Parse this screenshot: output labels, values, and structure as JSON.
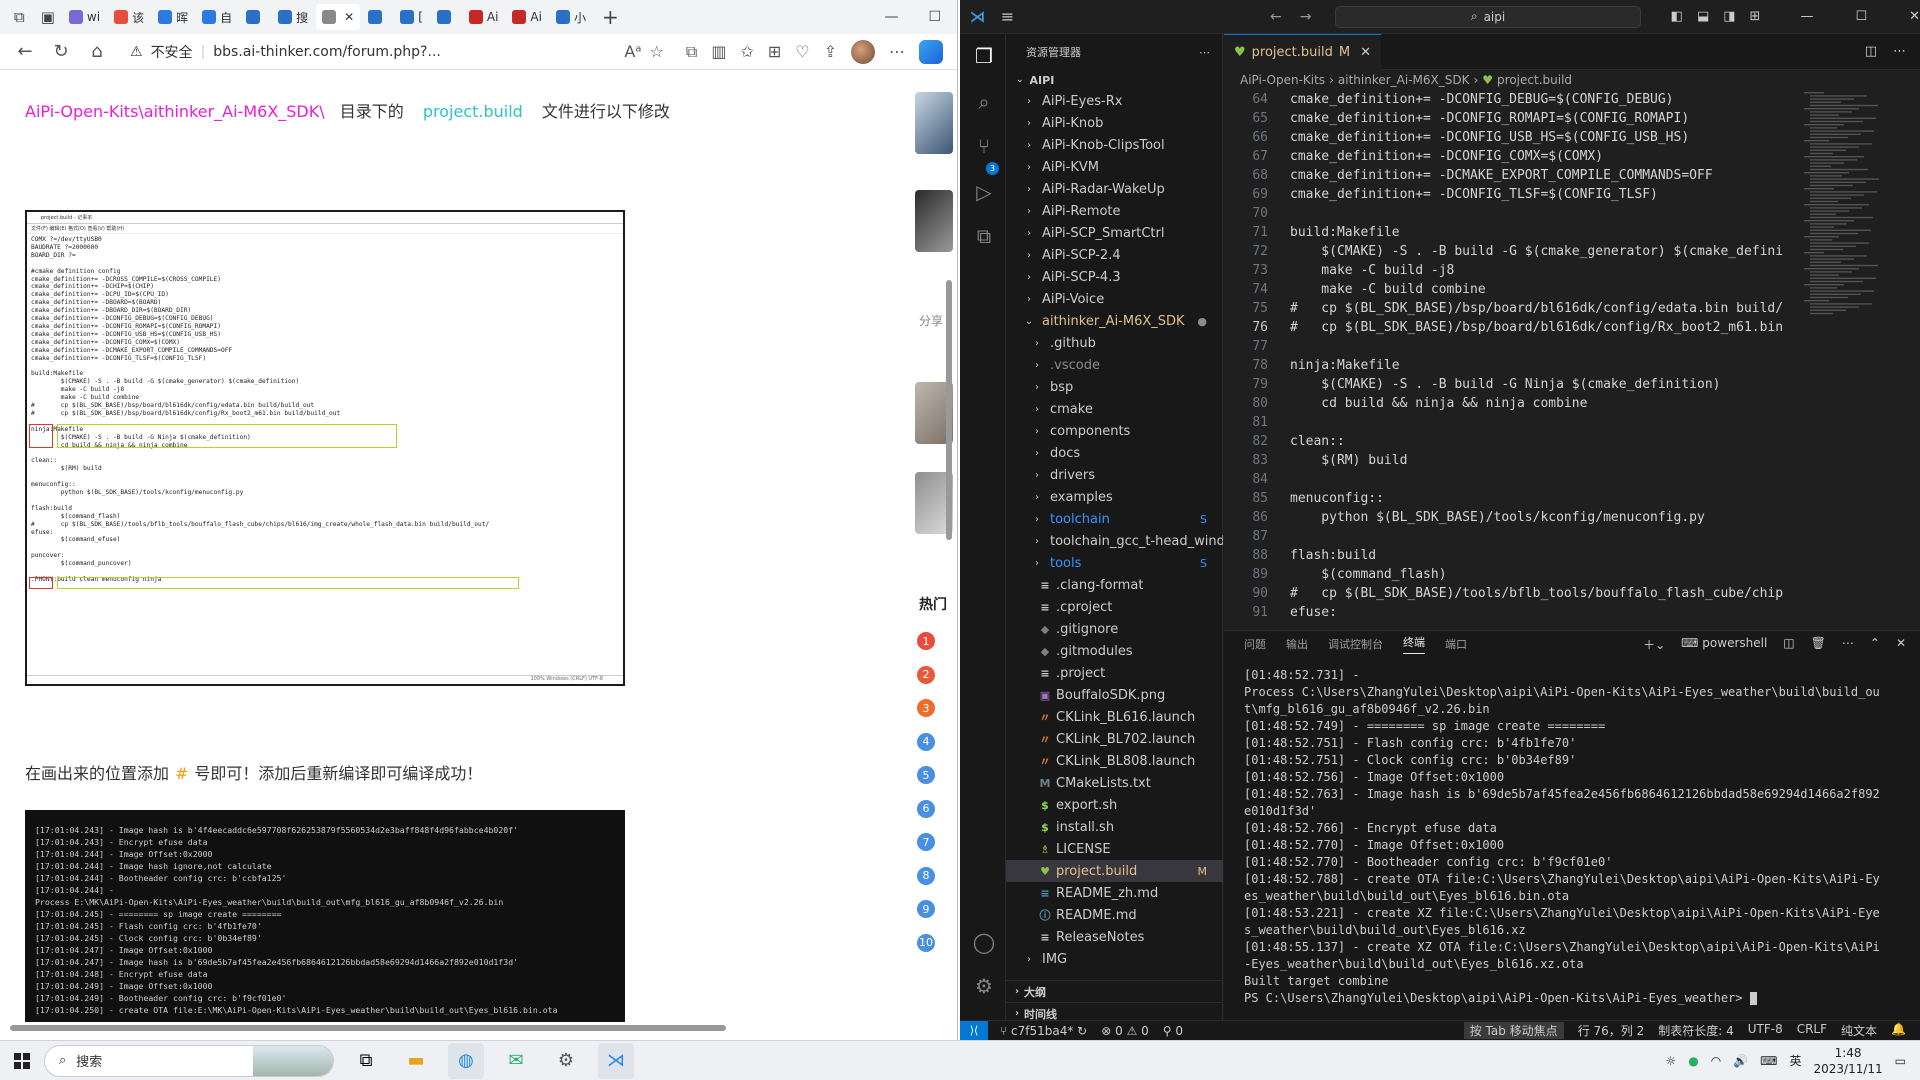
{
  "browser": {
    "tabs": [
      {
        "label": "wi",
        "color": "#7c69d8"
      },
      {
        "label": "该",
        "color": "#e74c3c"
      },
      {
        "label": "晖",
        "color": "#2a7ae2"
      },
      {
        "label": "自",
        "color": "#2a7ae2"
      },
      {
        "label": "",
        "color": "#2a70c8"
      },
      {
        "label": "搜",
        "color": "#2a70c8"
      },
      {
        "label": "",
        "color": "#888888"
      },
      {
        "label": "",
        "color": "#2a70c8"
      },
      {
        "label": "[",
        "color": "#2a70c8"
      },
      {
        "label": "",
        "color": "#2a70c8"
      },
      {
        "label": "Ai",
        "color": "#c62828"
      },
      {
        "label": "Ai",
        "color": "#c62828"
      },
      {
        "label": "小",
        "color": "#2a70c8"
      }
    ],
    "insecure_label": "不安全",
    "url": "bbs.ai-thinker.com/forum.php?...",
    "article": {
      "path": "AiPi-Open-Kits\\aithinker_Ai-M6X_SDK\\",
      "text1": "目录下的",
      "file": "project.build",
      "text2": "文件进行以下修改",
      "para_before": "在画出来的位置添加",
      "hash": "#",
      "para_after": "号即可！添加后重新编译即可编译成功！"
    },
    "notepad": {
      "title": "project.build - 记事本",
      "menu": "文件(F)   编辑(E)   格式(O)   查看(V)   帮助(H)",
      "body": "COMX ?=/dev/ttyUSB0\nBAUDRATE ?=2000000\nBOARD_DIR ?=\n\n#cmake definition config\ncmake_definition+= -DCROSS_COMPILE=$(CROSS_COMPILE)\ncmake_definition+= -DCHIP=$(CHIP)\ncmake_definition+= -DCPU_ID=$(CPU_ID)\ncmake_definition+= -DBOARD=$(BOARD)\ncmake_definition+= -DBOARD_DIR=$(BOARD_DIR)\ncmake_definition+= -DCONFIG_DEBUG=$(CONFIG_DEBUG)\ncmake_definition+= -DCONFIG_ROMAPI=$(CONFIG_ROMAPI)\ncmake_definition+= -DCONFIG_USB_HS=$(CONFIG_USB_HS)\ncmake_definition+= -DCONFIG_COMX=$(COMX)\ncmake_definition+= -DCMAKE_EXPORT_COMPILE_COMMANDS=OFF\ncmake_definition+= -DCONFIG_TLSF=$(CONFIG_TLSF)\n\nbuild:Makefile\n        $(CMAKE) -S . -B build -G $(cmake_generator) $(cmake_definition)\n        make -C build -j8\n        make -C build combine\n#       cp $(BL_SDK_BASE)/bsp/board/bl616dk/config/edata.bin build/build_out\n#       cp $(BL_SDK_BASE)/bsp/board/bl616dk/config/Rx_boot2_m61.bin build/build_out\n\nninja:Makefile\n        $(CMAKE) -S . -B build -G Ninja $(cmake_definition)\n        cd build && ninja && ninja combine\n\nclean::\n        $(RM) build\n\nmenuconfig::\n        python $(BL_SDK_BASE)/tools/kconfig/menuconfig.py\n\nflash:build\n        $(command_flash)\n#       cp $(BL_SDK_BASE)/tools/bflb_tools/bouffalo_flash_cube/chips/bl616/img_create/whole_flash_data.bin build/build_out/\nefuse:\n        $(command_efuse)\n\npuncover:\n        $(command_puncover)\n\n.PHONY:build clean menuconfig ninja",
      "status": "100%    Windows (CRLF)    UTF-8"
    },
    "log_lines": [
      "[17:01:04.243] - Image hash is b'4f4eecaddc6e597708f626253879f5560534d2e3baff848f4d96fabbce4b020f'",
      "[17:01:04.243] - Encrypt efuse data",
      "[17:01:04.244] - Image Offset:0x2000",
      "[17:01:04.244] - Image hash ignore,not calculate",
      "[17:01:04.244] - Bootheader config crc: b'ccbfa125'",
      "[17:01:04.244] -",
      "Process E:\\MK\\AiPi-Open-Kits\\AiPi-Eyes_weather\\build\\build_out\\mfg_bl616_gu_af8b0946f_v2.26.bin",
      "[17:01:04.245] - ======== sp image create ========",
      "[17:01:04.245] - Flash config crc: b'4fb1fe70'",
      "[17:01:04.245] - Clock config crc: b'0b34ef89'",
      "[17:01:04.247] - Image Offset:0x1000",
      "[17:01:04.247] - Image hash is b'69de5b7af45fea2e456fb6864612126bbdad58e69294d1466a2f892e010d1f3d'",
      "[17:01:04.248] - Encrypt efuse data",
      "[17:01:04.249] - Image Offset:0x1000",
      "[17:01:04.249] - Bootheader config crc: b'f9cf01e0'",
      "[17:01:04.250] - create OTA file:E:\\MK\\AiPi-Open-Kits\\AiPi-Eyes_weather\\build\\build_out\\Eyes_bl616.bin.ota"
    ],
    "rail": {
      "share": "分享",
      "hot": "热门",
      "numbers": [
        "1",
        "2",
        "3",
        "4",
        "5",
        "6",
        "7",
        "8",
        "9",
        "10"
      ]
    }
  },
  "vscode": {
    "search": "aipi",
    "explorer_title": "资源管理器",
    "root": "AIPI",
    "tree": [
      {
        "label": "AiPi-Eyes-Rx",
        "type": "folder",
        "indent": 1
      },
      {
        "label": "AiPi-Knob",
        "type": "folder",
        "indent": 1
      },
      {
        "label": "AiPi-Knob-ClipsTool",
        "type": "folder",
        "indent": 1
      },
      {
        "label": "AiPi-KVM",
        "type": "folder",
        "indent": 1
      },
      {
        "label": "AiPi-Radar-WakeUp",
        "type": "folder",
        "indent": 1
      },
      {
        "label": "AiPi-Remote",
        "type": "folder",
        "indent": 1
      },
      {
        "label": "AiPi-SCP_SmartCtrl",
        "type": "folder",
        "indent": 1
      },
      {
        "label": "AiPi-SCP-2.4",
        "type": "folder",
        "indent": 1
      },
      {
        "label": "AiPi-SCP-4.3",
        "type": "folder",
        "indent": 1
      },
      {
        "label": "AiPi-Voice",
        "type": "folder",
        "indent": 1
      },
      {
        "label": "aithinker_Ai-M6X_SDK",
        "type": "folder-open",
        "indent": 1,
        "status": "●",
        "cls": "mod"
      },
      {
        "label": ".github",
        "type": "folder",
        "indent": 2
      },
      {
        "label": ".vscode",
        "type": "folder",
        "indent": 2,
        "cls": "dim"
      },
      {
        "label": "bsp",
        "type": "folder",
        "indent": 2
      },
      {
        "label": "cmake",
        "type": "folder",
        "indent": 2
      },
      {
        "label": "components",
        "type": "folder",
        "indent": 2
      },
      {
        "label": "docs",
        "type": "folder",
        "indent": 2
      },
      {
        "label": "drivers",
        "type": "folder",
        "indent": 2
      },
      {
        "label": "examples",
        "type": "folder",
        "indent": 2
      },
      {
        "label": "toolchain",
        "type": "folder",
        "indent": 2,
        "status": "S",
        "cls": "sub"
      },
      {
        "label": "toolchain_gcc_t-head_windows",
        "type": "folder",
        "indent": 2
      },
      {
        "label": "tools",
        "type": "folder",
        "indent": 2,
        "status": "S",
        "cls": "sub"
      },
      {
        "label": ".clang-format",
        "type": "file",
        "indent": 2,
        "icon": "≡",
        "icolor": "#cccccc"
      },
      {
        "label": ".cproject",
        "type": "file",
        "indent": 2,
        "icon": "≡",
        "icolor": "#cccccc"
      },
      {
        "label": ".gitignore",
        "type": "file",
        "indent": 2,
        "icon": "◆",
        "icolor": "#7f7f7f"
      },
      {
        "label": ".gitmodules",
        "type": "file",
        "indent": 2,
        "icon": "◆",
        "icolor": "#7f7f7f"
      },
      {
        "label": ".project",
        "type": "file",
        "indent": 2,
        "icon": "≡",
        "icolor": "#cccccc"
      },
      {
        "label": "BouffaloSDK.png",
        "type": "file",
        "indent": 2,
        "icon": "▣",
        "icolor": "#a074c4"
      },
      {
        "label": "CKLink_BL616.launch",
        "type": "file",
        "indent": 2,
        "icon": "〃",
        "icolor": "#e37933"
      },
      {
        "label": "CKLink_BL702.launch",
        "type": "file",
        "indent": 2,
        "icon": "〃",
        "icolor": "#e37933"
      },
      {
        "label": "CKLink_BL808.launch",
        "type": "file",
        "indent": 2,
        "icon": "〃",
        "icolor": "#e37933"
      },
      {
        "label": "CMakeLists.txt",
        "type": "file",
        "indent": 2,
        "icon": "M",
        "icolor": "#6d8086"
      },
      {
        "label": "export.sh",
        "type": "file",
        "indent": 2,
        "icon": "$",
        "icolor": "#89e051"
      },
      {
        "label": "install.sh",
        "type": "file",
        "indent": 2,
        "icon": "$",
        "icolor": "#89e051"
      },
      {
        "label": "LICENSE",
        "type": "file",
        "indent": 2,
        "icon": "♗",
        "icolor": "#cbcb41"
      },
      {
        "label": "project.build",
        "type": "file",
        "indent": 2,
        "icon": "♥",
        "icolor": "#8dc149",
        "status": "M",
        "cls": "mod sel"
      },
      {
        "label": "README_zh.md",
        "type": "file",
        "indent": 2,
        "icon": "≡",
        "icolor": "#519aba"
      },
      {
        "label": "README.md",
        "type": "file",
        "indent": 2,
        "icon": "ⓘ",
        "icolor": "#519aba"
      },
      {
        "label": "ReleaseNotes",
        "type": "file",
        "indent": 2,
        "icon": "≡",
        "icolor": "#cccccc"
      },
      {
        "label": "IMG",
        "type": "folder",
        "indent": 1
      }
    ],
    "outline_label": "大纲",
    "timeline_label": "时间线",
    "tab_label": "project.build",
    "tab_status": "M",
    "crumbs": [
      "AiPi-Open-Kits",
      "aithinker_Ai-M6X_SDK",
      "project.build"
    ],
    "code": [
      {
        "n": "64",
        "t": "cmake_definition+= -DCONFIG_DEBUG=$(CONFIG_DEBUG)"
      },
      {
        "n": "65",
        "t": "cmake_definition+= -DCONFIG_ROMAPI=$(CONFIG_ROMAPI)"
      },
      {
        "n": "66",
        "t": "cmake_definition+= -DCONFIG_USB_HS=$(CONFIG_USB_HS)"
      },
      {
        "n": "67",
        "t": "cmake_definition+= -DCONFIG_COMX=$(COMX)"
      },
      {
        "n": "68",
        "t": "cmake_definition+= -DCMAKE_EXPORT_COMPILE_COMMANDS=OFF"
      },
      {
        "n": "69",
        "t": "cmake_definition+= -DCONFIG_TLSF=$(CONFIG_TLSF)"
      },
      {
        "n": "70",
        "t": ""
      },
      {
        "n": "71",
        "t": "build:Makefile"
      },
      {
        "n": "72",
        "t": "    $(CMAKE) -S . -B build -G $(cmake_generator) $(cmake_definiti"
      },
      {
        "n": "73",
        "t": "    make -C build -j8"
      },
      {
        "n": "74",
        "t": "    make -C build combine"
      },
      {
        "n": "75",
        "t": "#   cp $(BL_SDK_BASE)/bsp/board/bl616dk/config/edata.bin build/bu"
      },
      {
        "n": "76",
        "t": "#   cp $(BL_SDK_BASE)/bsp/board/bl616dk/config/Rx_boot2_m61.bin b"
      },
      {
        "n": "77",
        "t": ""
      },
      {
        "n": "78",
        "t": "ninja:Makefile"
      },
      {
        "n": "79",
        "t": "    $(CMAKE) -S . -B build -G Ninja $(cmake_definition)"
      },
      {
        "n": "80",
        "t": "    cd build && ninja && ninja combine"
      },
      {
        "n": "81",
        "t": ""
      },
      {
        "n": "82",
        "t": "clean::"
      },
      {
        "n": "83",
        "t": "    $(RM) build"
      },
      {
        "n": "84",
        "t": ""
      },
      {
        "n": "85",
        "t": "menuconfig::"
      },
      {
        "n": "86",
        "t": "    python $(BL_SDK_BASE)/tools/kconfig/menuconfig.py"
      },
      {
        "n": "87",
        "t": ""
      },
      {
        "n": "88",
        "t": "flash:build"
      },
      {
        "n": "89",
        "t": "    $(command_flash)"
      },
      {
        "n": "90",
        "t": "#   cp $(BL_SDK_BASE)/tools/bflb_tools/bouffalo_flash_cube/chips/"
      },
      {
        "n": "91",
        "t": "efuse:"
      }
    ],
    "current_line": "76",
    "panel_tabs": [
      "问题",
      "输出",
      "调试控制台",
      "终端",
      "端口"
    ],
    "panel_active": "终端",
    "shell_label": "powershell",
    "terminal": [
      "[01:48:52.731] -",
      "Process C:\\Users\\ZhangYulei\\Desktop\\aipi\\AiPi-Open-Kits\\AiPi-Eyes_weather\\build\\build_ou",
      "t\\mfg_bl616_gu_af8b0946f_v2.26.bin",
      "[01:48:52.749] - ======== sp image create ========",
      "[01:48:52.751] - Flash config crc: b'4fb1fe70'",
      "[01:48:52.751] - Clock config crc: b'0b34ef89'",
      "[01:48:52.756] - Image Offset:0x1000",
      "[01:48:52.763] - Image hash is b'69de5b7af45fea2e456fb6864612126bbdad58e69294d1466a2f892",
      "e010d1f3d'",
      "[01:48:52.766] - Encrypt efuse data",
      "[01:48:52.770] - Image Offset:0x1000",
      "[01:48:52.770] - Bootheader config crc: b'f9cf01e0'",
      "[01:48:52.788] - create OTA file:C:\\Users\\ZhangYulei\\Desktop\\aipi\\AiPi-Open-Kits\\AiPi-Ey",
      "es_weather\\build\\build_out\\Eyes_bl616.bin.ota",
      "[01:48:53.221] - create XZ file:C:\\Users\\ZhangYulei\\Desktop\\aipi\\AiPi-Open-Kits\\AiPi-Eye",
      "s_weather\\build\\build_out\\Eyes_bl616.xz",
      "[01:48:55.137] - create XZ OTA file:C:\\Users\\ZhangYulei\\Desktop\\aipi\\AiPi-Open-Kits\\AiPi",
      "-Eyes_weather\\build\\build_out\\Eyes_bl616.xz.ota",
      "Built target combine",
      "PS C:\\Users\\ZhangYulei\\Desktop\\aipi\\AiPi-Open-Kits\\AiPi-Eyes_weather> "
    ],
    "status": {
      "branch": "c7f51ba4*",
      "errors": "0",
      "warnings": "0",
      "ports": "0",
      "tab_focus": "按 Tab 移动焦点",
      "position": "行 76，列 2",
      "tab_size": "制表符长度: 4",
      "encoding": "UTF-8",
      "eol": "CRLF",
      "language": "纯文本"
    }
  },
  "taskbar": {
    "search": "搜索",
    "ime": "英",
    "time": "1:48",
    "date": "2023/11/11"
  }
}
